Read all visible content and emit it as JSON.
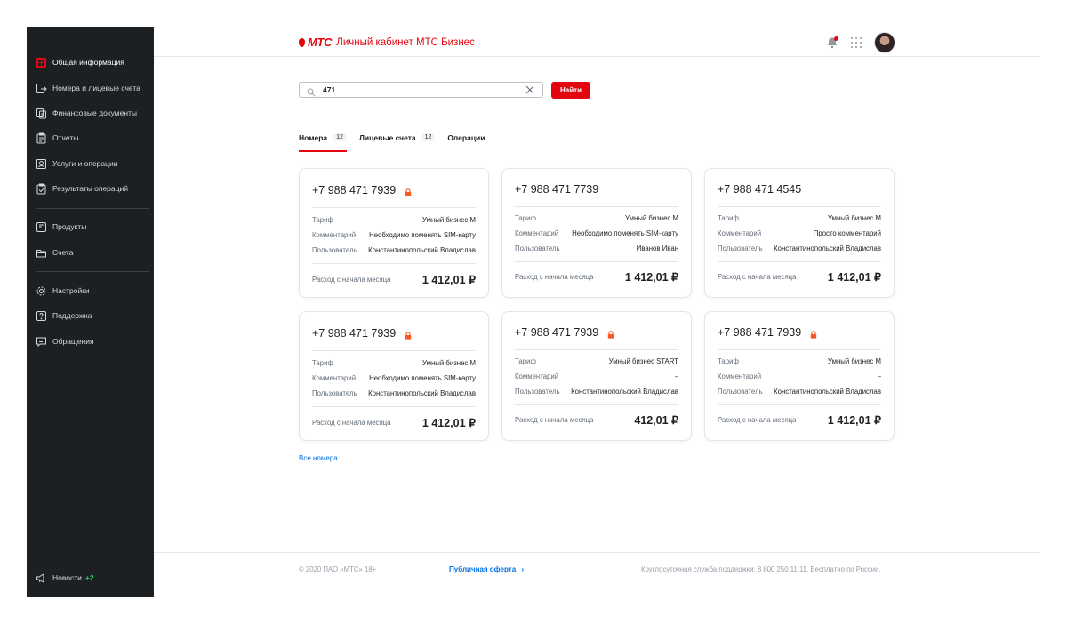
{
  "header": {
    "logo_text": "МТС",
    "title": "Личный кабинет МТС Бизнес"
  },
  "sidebar": {
    "items": [
      {
        "label": "Общая информация",
        "icon": "overview-icon"
      },
      {
        "label": "Номера и лицевые счета",
        "icon": "numbers-icon"
      },
      {
        "label": "Финансовые документы",
        "icon": "documents-icon"
      },
      {
        "label": "Отчеты",
        "icon": "report-icon"
      },
      {
        "label": "Услуги и операции",
        "icon": "services-icon"
      },
      {
        "label": "Результаты операций",
        "icon": "results-icon"
      },
      {
        "label": "Продукты",
        "icon": "products-icon"
      },
      {
        "label": "Счета",
        "icon": "folder-icon"
      },
      {
        "label": "Настройки",
        "icon": "gear-icon"
      },
      {
        "label": "Поддержка",
        "icon": "help-icon"
      },
      {
        "label": "Обращения",
        "icon": "chat-icon"
      }
    ],
    "news_label": "Новости",
    "news_count": "+2"
  },
  "search": {
    "value": "471",
    "button_label": "Найти"
  },
  "tabs": [
    {
      "label": "Номера",
      "count": "12"
    },
    {
      "label": "Лицевые счета",
      "count": "12"
    },
    {
      "label": "Операции",
      "count": ""
    }
  ],
  "labels": {
    "tariff": "Тариф",
    "comment": "Комментарий",
    "user": "Пользователь",
    "spend": "Расход с начала месяца"
  },
  "cards": [
    {
      "phone": "+7 988 471 7939",
      "locked": true,
      "tariff": "Умный бизнес М",
      "comment": "Необходимо поменять SIM-карту",
      "user": "Константинопольский Владислав",
      "amount": "1 412,01 ₽"
    },
    {
      "phone": "+7 988 471 7739",
      "locked": false,
      "tariff": "Умный бизнес М",
      "comment": "Необходимо поменять SIM-карту",
      "user": "Иванов Иван",
      "amount": "1 412,01 ₽"
    },
    {
      "phone": "+7 988 471 4545",
      "locked": false,
      "tariff": "Умный бизнес М",
      "comment": "Просто комментарий",
      "user": "Константинопольский Владислав",
      "amount": "1 412,01 ₽"
    },
    {
      "phone": "+7 988 471 7939",
      "locked": true,
      "tariff": "Умный бизнес М",
      "comment": "Необходимо поменять SIM-карту",
      "user": "Константинопольский Владислав",
      "amount": "1 412,01 ₽"
    },
    {
      "phone": "+7 988 471 7939",
      "locked": true,
      "tariff": "Умный бизнес START",
      "comment": "–",
      "user": "Константинопольский Владислав",
      "amount": "412,01 ₽"
    },
    {
      "phone": "+7 988 471 7939",
      "locked": true,
      "tariff": "Умный бизнес М",
      "comment": "–",
      "user": "Константинопольский Владислав",
      "amount": "1 412,01 ₽"
    }
  ],
  "all_numbers_link": "Все номера",
  "footer": {
    "copyright": "© 2020 ПАО «МТС» 18+",
    "offer_link": "Публичная оферта",
    "support": "Круглосуточная служба поддержки: 8 800 250 11 11. Бесплатно по России."
  },
  "colors": {
    "brand_red": "#e30611",
    "sidebar_bg": "#1d2023",
    "link_blue": "#0070e5",
    "news_green": "#26cd58",
    "lock_orange": "#f95721"
  }
}
